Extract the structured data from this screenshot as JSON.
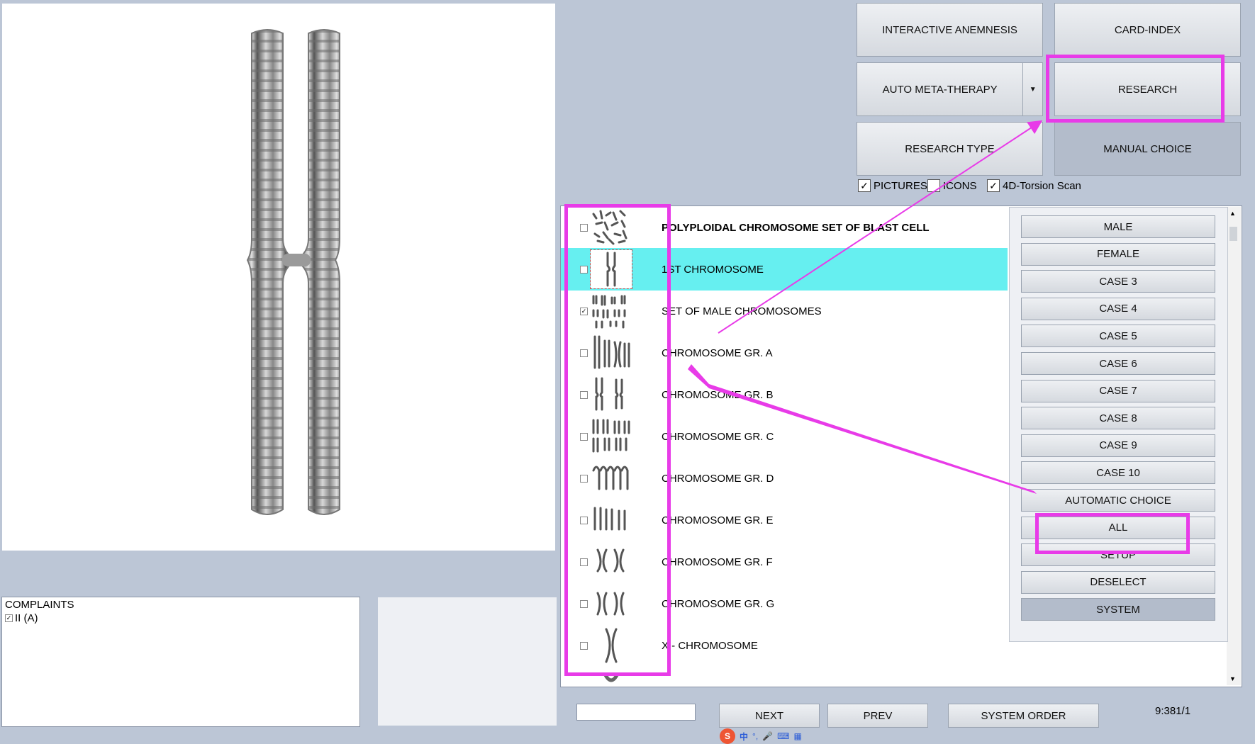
{
  "top_buttons": {
    "interactive_anemnesis": "INTERACTIVE ANEMNESIS",
    "card_index": "CARD-INDEX",
    "auto_meta_therapy": "AUTO META-THERAPY",
    "research": "RESEARCH",
    "research_type": "RESEARCH TYPE",
    "manual_choice": "MANUAL CHOICE"
  },
  "options": {
    "pictures": {
      "label": "PICTURES",
      "checked": true
    },
    "icons": {
      "label": "ICONS",
      "checked": false
    },
    "torsion": {
      "label": "4D-Torsion Scan",
      "checked": true
    }
  },
  "list_items": [
    {
      "label": "POLYPLOIDAL CHROMOSOME SET OF BLAST CELL",
      "checked": false,
      "bold": true
    },
    {
      "label": "1ST CHROMOSOME",
      "checked": false,
      "selected": true
    },
    {
      "label": "SET OF MALE CHROMOSOMES",
      "checked": true
    },
    {
      "label": "CHROMOSOME GR. A",
      "checked": false
    },
    {
      "label": "CHROMOSOME GR. B",
      "checked": false
    },
    {
      "label": "CHROMOSOME GR. C",
      "checked": false
    },
    {
      "label": "CHROMOSOME GR. D",
      "checked": false
    },
    {
      "label": "CHROMOSOME GR. E",
      "checked": false
    },
    {
      "label": "CHROMOSOME GR. F",
      "checked": false
    },
    {
      "label": "CHROMOSOME GR. G",
      "checked": false
    },
    {
      "label": "X - CHROMOSOME",
      "checked": false
    }
  ],
  "side_buttons": [
    "MALE",
    "FEMALE",
    "CASE 3",
    "CASE 4",
    "CASE 5",
    "CASE 6",
    "CASE 7",
    "CASE 8",
    "CASE 9",
    "CASE 10",
    "AUTOMATIC CHOICE",
    "ALL",
    "SETUP",
    "DESELECT",
    "SYSTEM"
  ],
  "complaints": {
    "title": "COMPLAINTS",
    "item": "II (A)"
  },
  "bottom": {
    "next": "NEXT",
    "prev": "PREV",
    "system_order": "SYSTEM ORDER",
    "counter": "9:381/1"
  },
  "taskbar": {
    "ime_char": "中",
    "app_icon_letter": "S"
  },
  "accent": "#e83be8",
  "selected_color": "#66eff0"
}
